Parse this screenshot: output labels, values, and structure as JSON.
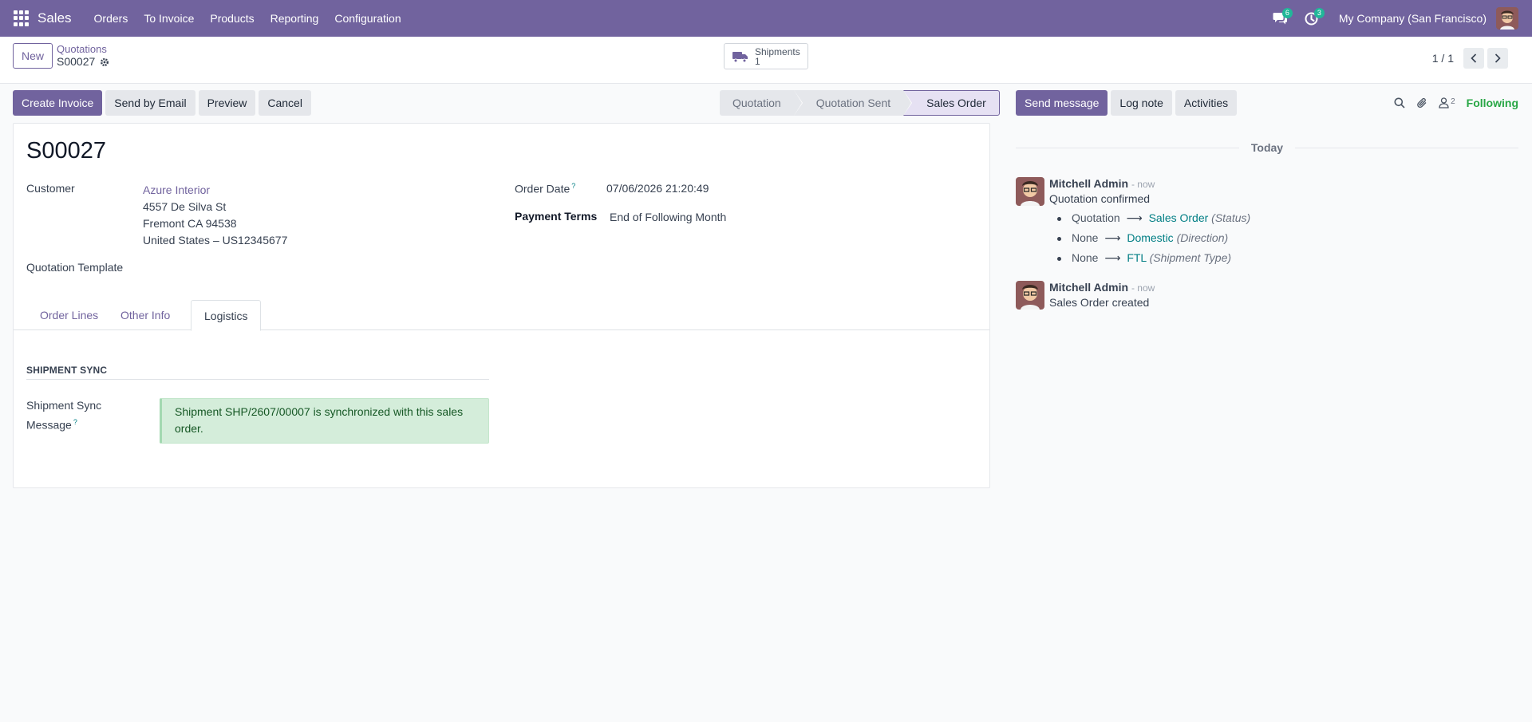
{
  "topnav": {
    "app_name": "Sales",
    "menu": [
      "Orders",
      "To Invoice",
      "Products",
      "Reporting",
      "Configuration"
    ],
    "messages_badge": "6",
    "activities_badge": "3",
    "company": "My Company (San Francisco)"
  },
  "control_panel": {
    "new_label": "New",
    "breadcrumb_parent": "Quotations",
    "breadcrumb_current": "S00027",
    "smart_button": {
      "label": "Shipments",
      "count": "1"
    },
    "pager": "1 / 1"
  },
  "actions": {
    "create_invoice": "Create Invoice",
    "send_by_email": "Send by Email",
    "preview": "Preview",
    "cancel": "Cancel"
  },
  "statusbar": {
    "stages": [
      "Quotation",
      "Quotation Sent",
      "Sales Order"
    ],
    "active": "Sales Order"
  },
  "form": {
    "title": "S00027",
    "customer_label": "Customer",
    "customer": {
      "name": "Azure Interior",
      "street": "4557 De Silva St",
      "city": "Fremont CA 94538",
      "country": "United States – US12345677"
    },
    "quotation_template_label": "Quotation Template",
    "order_date_label": "Order Date",
    "order_date_help": "?",
    "order_date": "07/06/2026 21:20:49",
    "payment_terms_label": "Payment Terms",
    "payment_terms": "End of Following Month",
    "tabs": [
      "Order Lines",
      "Other Info",
      "Logistics"
    ],
    "active_tab": "Logistics",
    "section_title": "SHIPMENT SYNC",
    "sync_label_line1": "Shipment Sync",
    "sync_label_line2": "Message",
    "sync_help": "?",
    "sync_message": "Shipment SHP/2607/00007 is synchronized with this sales order."
  },
  "chatter": {
    "send_message": "Send message",
    "log_note": "Log note",
    "activities": "Activities",
    "followers_count": "2",
    "following": "Following",
    "date_separator": "Today",
    "messages": [
      {
        "author": "Mitchell Admin",
        "time": "- now",
        "text": "Quotation confirmed",
        "tracking": [
          {
            "old": "Quotation",
            "new": "Sales Order",
            "field": "(Status)"
          },
          {
            "old": "None",
            "new": "Domestic",
            "field": "(Direction)"
          },
          {
            "old": "None",
            "new": "FTL",
            "field": "(Shipment Type)"
          }
        ]
      },
      {
        "author": "Mitchell Admin",
        "time": "- now",
        "text": "Sales Order created"
      }
    ]
  },
  "colors": {
    "brand": "#71639e",
    "success_bg": "#d4edda",
    "link_teal": "#017e84",
    "following_green": "#28a745"
  }
}
